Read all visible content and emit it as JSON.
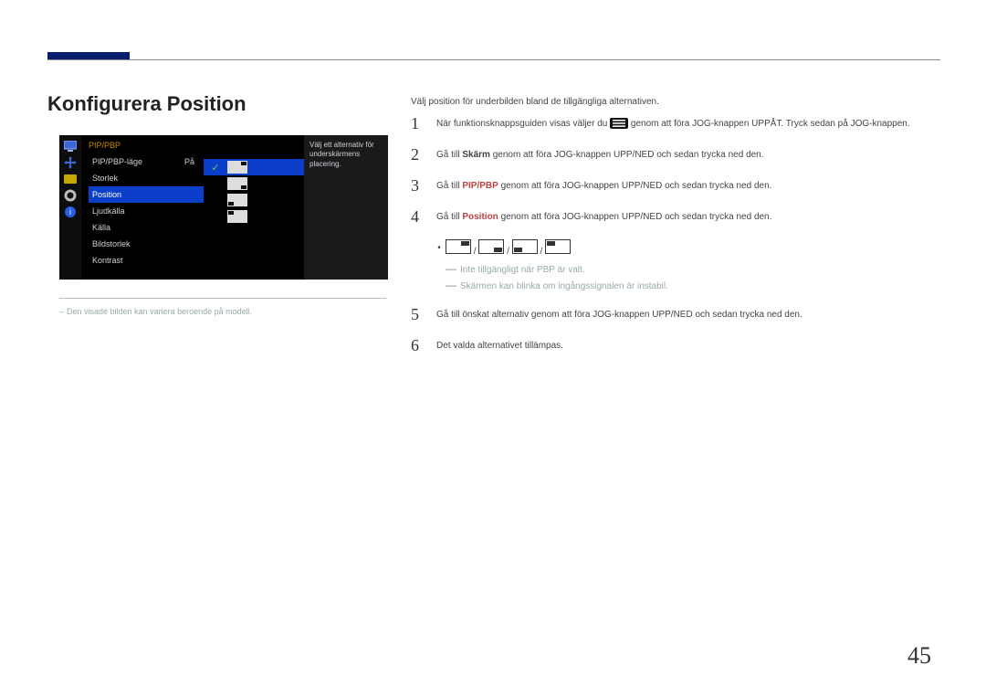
{
  "page_number": "45",
  "title": "Konfigurera Position",
  "intro": "Välj position för underbilden bland de tillgängliga alternativen.",
  "osd": {
    "category": "PIP/PBP",
    "help": "Välj ett alternativ för underskärmens placering.",
    "items": [
      {
        "label": "PIP/PBP-läge",
        "value": "På"
      },
      {
        "label": "Storlek"
      },
      {
        "label": "Position",
        "selected": true
      },
      {
        "label": "Ljudkälla"
      },
      {
        "label": "Källa"
      },
      {
        "label": "Bildstorlek"
      },
      {
        "label": "Kontrast"
      }
    ],
    "options": [
      {
        "pos": "tr",
        "selected": true
      },
      {
        "pos": "br"
      },
      {
        "pos": "bl"
      },
      {
        "pos": "tl"
      }
    ]
  },
  "footnote": "Den visade bilden kan variera beroende på modell.",
  "steps": [
    {
      "n": "1",
      "pre": "När funktionsknappsguiden visas väljer du ",
      "post": " genom att föra JOG-knappen UPPÅT. Tryck sedan på JOG-knappen."
    },
    {
      "n": "2",
      "pre": "Gå till ",
      "bold": "Skärm",
      "post": " genom att föra JOG-knappen UPP/NED och sedan trycka ned den."
    },
    {
      "n": "3",
      "pre": "Gå till ",
      "bold_red": "PIP/PBP",
      "post": " genom att föra JOG-knappen UPP/NED och sedan trycka ned den."
    },
    {
      "n": "4",
      "pre": "Gå till ",
      "bold_red": "Position",
      "post": " genom att föra JOG-knappen UPP/NED och sedan trycka ned den."
    }
  ],
  "bullets": {
    "positions": [
      "tr",
      "br",
      "bl",
      "tl"
    ],
    "notes": [
      "Inte tillgängligt när PBP är valt.",
      "Skärmen kan blinka om ingångssignalen är instabil."
    ]
  },
  "steps_after": [
    {
      "n": "5",
      "text": "Gå till önskat alternativ genom att föra JOG-knappen UPP/NED och sedan trycka ned den."
    },
    {
      "n": "6",
      "text": "Det valda alternativet tillämpas."
    }
  ]
}
